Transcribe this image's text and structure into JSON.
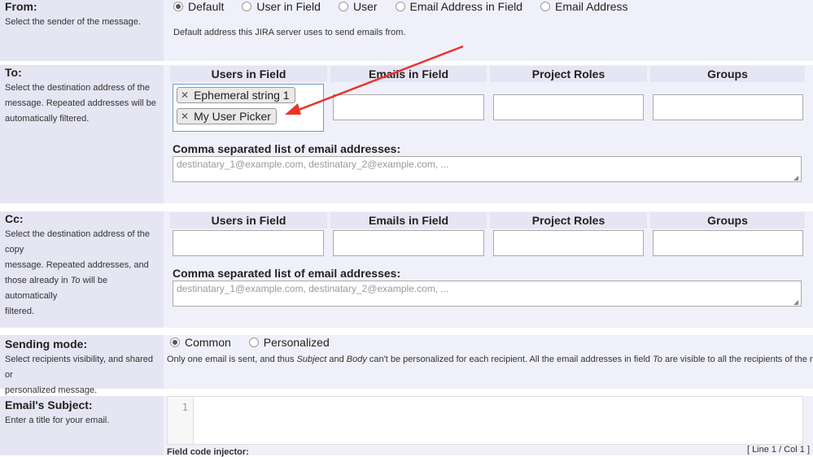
{
  "from": {
    "title": "From:",
    "desc": "Select the sender of the message.",
    "options": [
      "Default",
      "User in Field",
      "User",
      "Email Address in Field",
      "Email Address"
    ],
    "selected": "Default",
    "help": "Default address this JIRA server uses to send emails from."
  },
  "to": {
    "title": "To:",
    "desc_lines": [
      "Select the destination address of the",
      "message. Repeated addresses will be",
      "automatically filtered."
    ],
    "columns": [
      "Users in Field",
      "Emails in Field",
      "Project Roles",
      "Groups"
    ],
    "selected_users": [
      "Ephemeral string 1",
      "My User Picker"
    ],
    "csv_label": "Comma separated list of email addresses:",
    "csv_placeholder": "destinatary_1@example.com, destinatary_2@example.com, ..."
  },
  "cc": {
    "title": "Cc:",
    "desc_line1": "Select the destination address of the copy",
    "desc_line2": "message. Repeated addresses, and",
    "desc_line3_pre": "those already in ",
    "desc_line3_em": "To",
    "desc_line3_post": " will be automatically",
    "desc_line4": "filtered.",
    "columns": [
      "Users in Field",
      "Emails in Field",
      "Project Roles",
      "Groups"
    ],
    "csv_label": "Comma separated list of email addresses:",
    "csv_placeholder": "destinatary_1@example.com, destinatary_2@example.com, ..."
  },
  "sending_mode": {
    "title": "Sending mode:",
    "desc_lines": [
      "Select recipients visibility, and shared or",
      "personalized message."
    ],
    "options": [
      "Common",
      "Personalized"
    ],
    "selected": "Common",
    "help_1": "Only one email is sent, and thus ",
    "help_em1": "Subject",
    "help_2": " and ",
    "help_em2": "Body",
    "help_3": " can't be personalized for each recipient. All the email addresses in field ",
    "help_em3": "To",
    "help_4": " are visible to all the recipients of the message."
  },
  "subject": {
    "title": "Email's Subject:",
    "desc": "Enter a title for your email.",
    "line_number": "1",
    "status": "[ Line 1 / Col 1 ]",
    "field_code_injector": "Field code injector:"
  },
  "colors": {
    "label_bg": "#e5e5f3",
    "content_bg": "#f0f0fa",
    "arrow": "#e8342a"
  }
}
